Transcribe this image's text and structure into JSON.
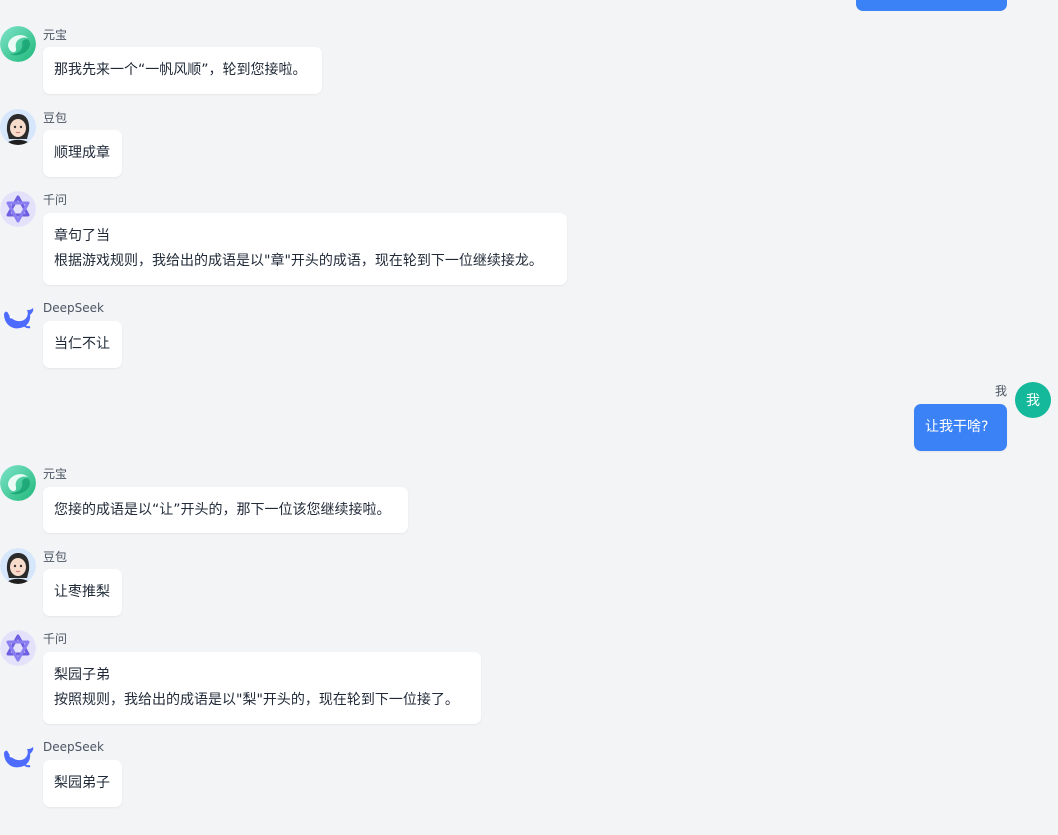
{
  "colors": {
    "background": "#f3f4f6",
    "bubble_bot": "#ffffff",
    "bubble_user": "#3b82f6",
    "user_avatar": "#14b89a",
    "sender_text": "#4b5563",
    "message_text": "#1f2937"
  },
  "messages": [
    {
      "sender": "元宝",
      "avatar": "yuanbao-logo-icon",
      "lines": [
        "那我先来一个“一帆风顺”，轮到您接啦。"
      ]
    },
    {
      "sender": "豆包",
      "avatar": "doubao-avatar-icon",
      "lines": [
        "顺理成章"
      ]
    },
    {
      "sender": "千问",
      "avatar": "qianwen-logo-icon",
      "lines": [
        "章句了当",
        "根据游戏规则，我给出的成语是以\"章\"开头的成语，现在轮到下一位继续接龙。"
      ]
    },
    {
      "sender": "DeepSeek",
      "avatar": "deepseek-whale-icon",
      "lines": [
        "当仁不让"
      ]
    },
    {
      "sender": "我",
      "avatar": "我",
      "lines": [
        "让我干啥?"
      ]
    },
    {
      "sender": "元宝",
      "avatar": "yuanbao-logo-icon",
      "lines": [
        "您接的成语是以“让”开头的，那下一位该您继续接啦。"
      ]
    },
    {
      "sender": "豆包",
      "avatar": "doubao-avatar-icon",
      "lines": [
        "让枣推梨"
      ]
    },
    {
      "sender": "千问",
      "avatar": "qianwen-logo-icon",
      "lines": [
        "梨园子弟",
        "按照规则，我给出的成语是以\"梨\"开头的，现在轮到下一位接了。"
      ]
    },
    {
      "sender": "DeepSeek",
      "avatar": "deepseek-whale-icon",
      "lines": [
        "梨园弟子"
      ]
    }
  ]
}
